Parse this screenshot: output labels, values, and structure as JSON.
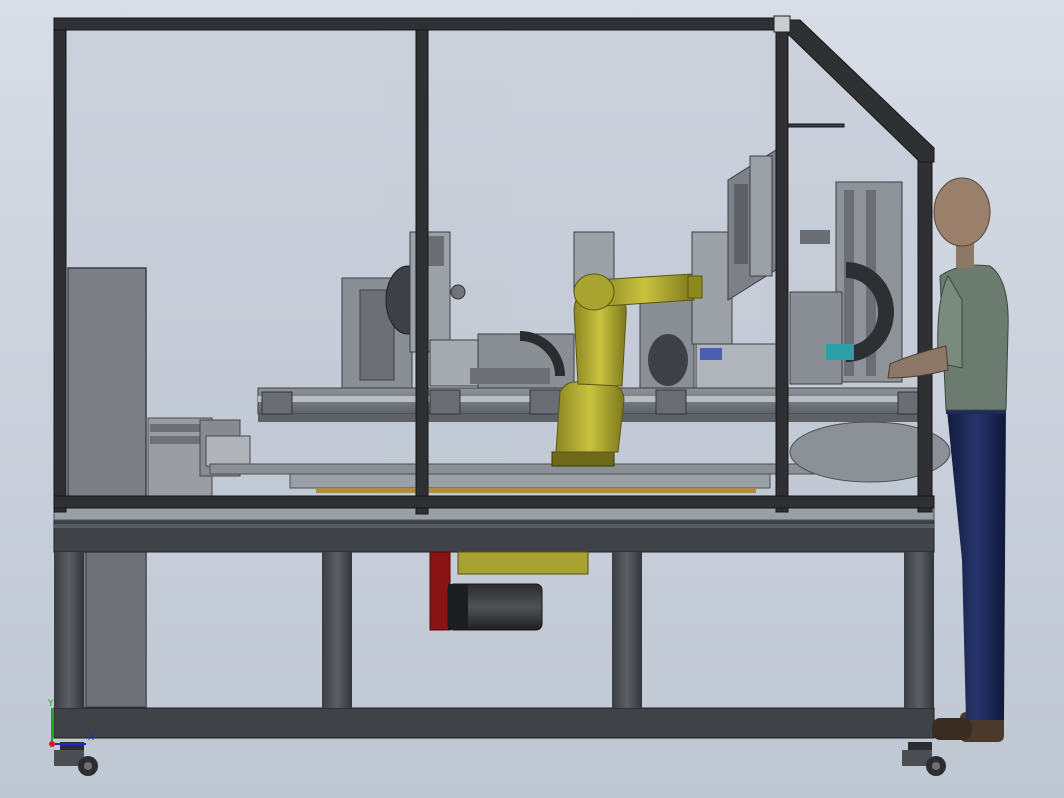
{
  "view": {
    "background_top": "#d8dde6",
    "background_bottom": "#bfc7d3",
    "frame_color": "#2e3033",
    "glass_color": "#b7bfca",
    "robot_color": "#b8b236",
    "worker_shirt_color": "#6b7b6f",
    "worker_pants_color": "#1c2a57",
    "worker_skin_color": "#8d7766",
    "motor_red_color": "#8a1414"
  },
  "triad": {
    "x_label": "X",
    "y_label": "Y",
    "z_label": "Z",
    "x_color": "#1a2bd6",
    "y_color": "#1ea31e",
    "z_color": "#d41a1a"
  }
}
